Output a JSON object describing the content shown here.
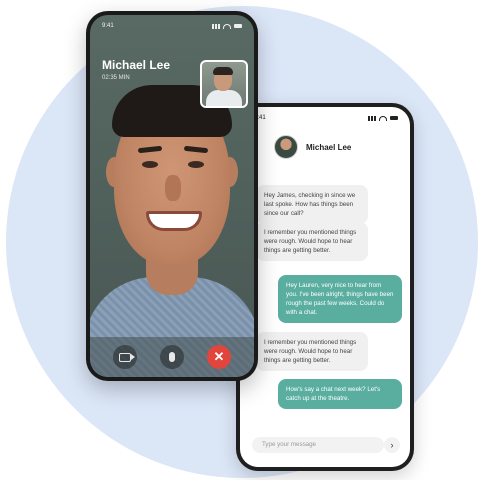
{
  "video_call": {
    "status_time": "9:41",
    "caller_name": "Michael Lee",
    "call_duration": "02:35 MIN"
  },
  "chat": {
    "status_time": "9:41",
    "contact_name": "Michael Lee",
    "messages": [
      {
        "direction": "incoming",
        "text": "Hey James, checking in since we last spoke. How has things been since our call?"
      },
      {
        "direction": "incoming",
        "text": "I remember you mentioned things were rough. Would hope to hear things are getting better."
      },
      {
        "direction": "outgoing",
        "text": "Hey Lauren, very nice to hear from you. I've been alright, things have been rough the past few weeks. Could do with a chat."
      },
      {
        "direction": "incoming",
        "text": "I remember you mentioned things were rough. Would hope to hear things are getting better."
      },
      {
        "direction": "outgoing",
        "text": "How's say a chat next week? Let's catch up at the theatre."
      }
    ],
    "input_placeholder": "Type your message",
    "send_icon": "›"
  },
  "colors": {
    "background_circle": "#dbe6f7",
    "outgoing_bubble": "#5aae9f",
    "incoming_bubble": "#f0f0f0",
    "end_call": "#e2453b"
  }
}
